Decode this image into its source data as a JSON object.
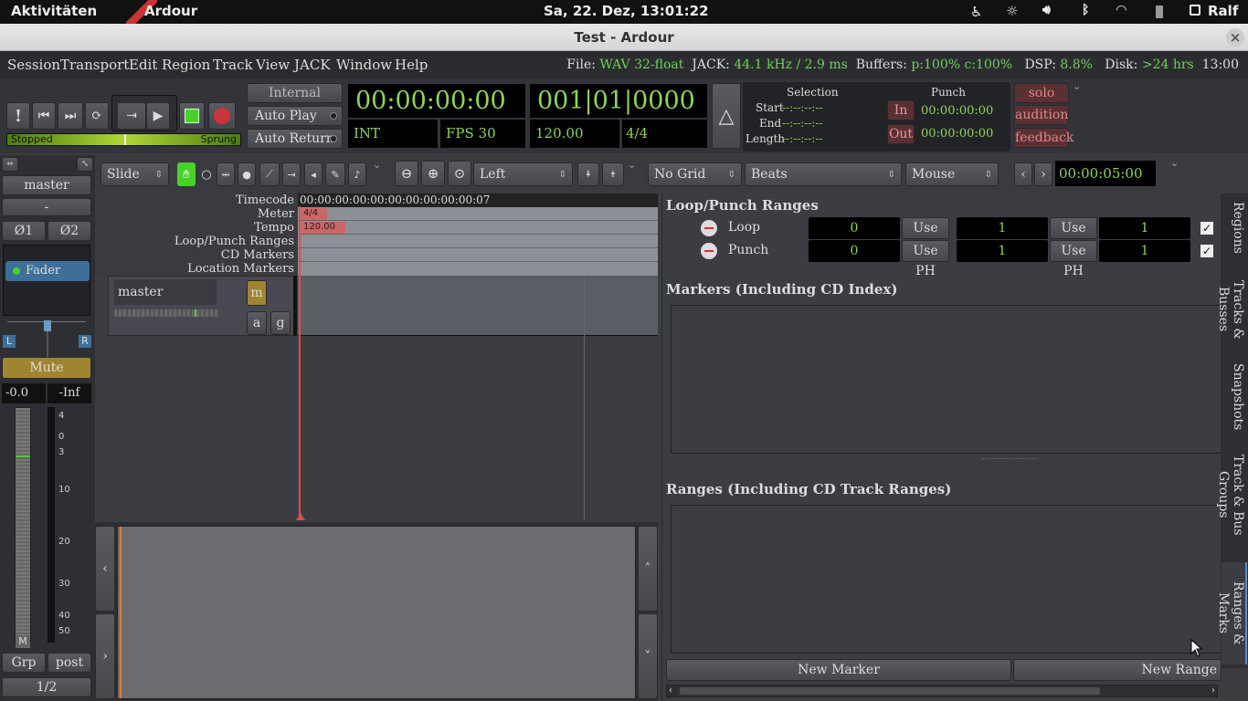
{
  "topbar": {
    "activities": "Aktivitäten",
    "app": "Ardour",
    "datetime": "Sa, 22. Dez, 13:01:22",
    "user": "Ralf"
  },
  "window": {
    "title": "Test - Ardour",
    "close": "×"
  },
  "menu": [
    "Session",
    "Transport",
    "Edit",
    "Region",
    "Track",
    "View",
    "JACK",
    "Window",
    "Help"
  ],
  "status": {
    "file_label": "File:",
    "file_value": "WAV 32-float",
    "jack_label": "JACK:",
    "jack_value": "44.1 kHz / 2.9 ms",
    "buffers_label": "Buffers:",
    "buffers_value": "p:100% c:100%",
    "dsp_label": "DSP:",
    "dsp_value": "8.8%",
    "disk_label": "Disk:",
    "disk_value": ">24 hrs",
    "time": "13:00"
  },
  "transport": {
    "stopped": "Stopped",
    "sprung": "Sprung",
    "internal": "Internal",
    "auto_play": "Auto Play",
    "auto_return": "Auto Return",
    "progress": 0.5
  },
  "clocks": {
    "primary": "00:00:00:00",
    "secondary": "001|01|0000",
    "int": "INT",
    "fps": "FPS 30",
    "bpm": "120.00",
    "meter": "4/4"
  },
  "selection": {
    "title": "Selection",
    "start": "Start",
    "end": "End",
    "length": "Length",
    "blank": "--:--:--:--"
  },
  "punch": {
    "title": "Punch",
    "in": "In",
    "out": "Out",
    "in_time": "00:00:00:00",
    "out_time": "00:00:00:00"
  },
  "monitor": {
    "solo": "solo",
    "audition": "audition",
    "feedback": "feedback"
  },
  "toolbar": {
    "edit_mode": "Slide",
    "zoom_focus": "Left",
    "grid": "No Grid",
    "grid_type": "Beats",
    "edit_point": "Mouse",
    "nudge_clock": "00:00:05:00"
  },
  "strip": {
    "name": "master",
    "dash": "-",
    "phase1": "Ø1",
    "phase2": "Ø2",
    "fader": "Fader",
    "L": "L",
    "R": "R",
    "mute": "Mute",
    "gain": "-0.0",
    "peak": "-Inf",
    "scale": [
      "4",
      "0",
      "3",
      "10",
      "20",
      "30",
      "40",
      "50"
    ],
    "M": "M",
    "grp": "Grp",
    "post": "post",
    "page": "1/2"
  },
  "rulers": {
    "timecode": "Timecode",
    "meter": "Meter",
    "tempo": "Tempo",
    "loop": "Loop/Punch Ranges",
    "cd": "CD Markers",
    "location": "Location Markers",
    "timecode_text": "00:00:00:00:00:00:00:00:00:00:07",
    "meter_mark": "4/4",
    "tempo_mark": "120.00"
  },
  "track": {
    "name": "master",
    "m": "m",
    "a": "a",
    "g": "g"
  },
  "summary": {
    "left": "‹",
    "right": "›",
    "up": "˄",
    "down": "˅"
  },
  "locations": {
    "title": "Loop/Punch Ranges",
    "rows": [
      {
        "name": "Loop",
        "v1": "0",
        "use1": "Use PH",
        "v2": "1",
        "use2": "Use PH",
        "v3": "1",
        "checked": true
      },
      {
        "name": "Punch",
        "v1": "0",
        "use1": "Use PH",
        "v2": "1",
        "use2": "Use PH",
        "v3": "1",
        "checked": true
      }
    ],
    "markers_title": "Markers (Including CD Index)",
    "ranges_title": "Ranges (Including CD Track Ranges)",
    "new_marker": "New Marker",
    "new_range": "New Range"
  },
  "sidetabs": [
    "Regions",
    "Tracks & Busses",
    "Snapshots",
    "Track & Bus Groups",
    "Ranges & Marks"
  ]
}
